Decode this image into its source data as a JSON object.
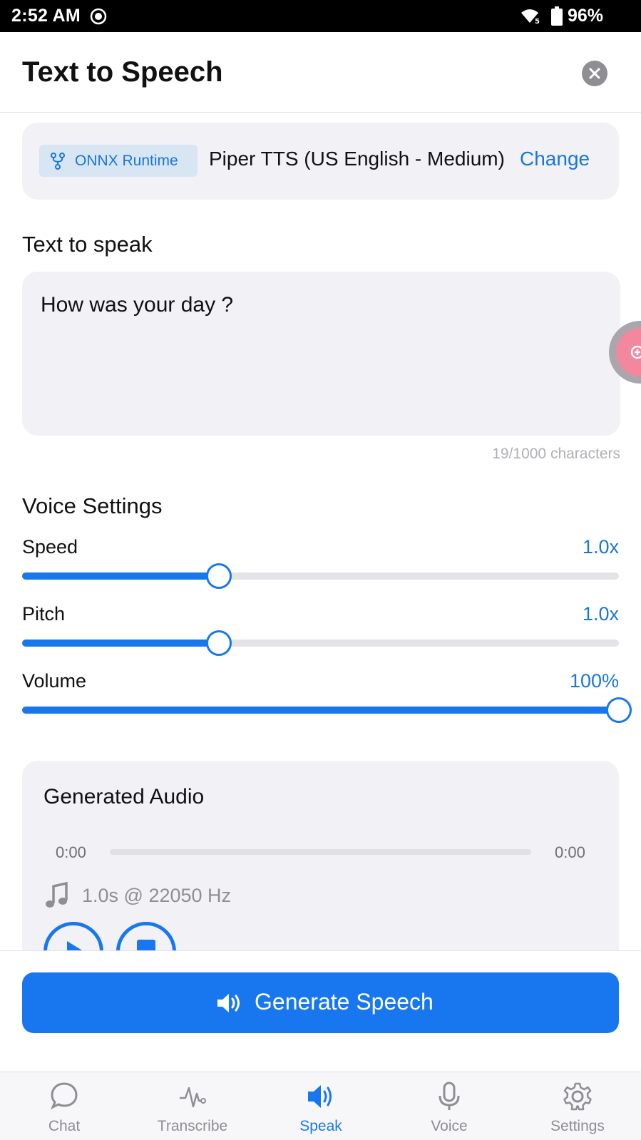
{
  "status_bar": {
    "time": "2:52 AM",
    "battery": "96%",
    "icons": [
      "recording-icon",
      "wifi-icon",
      "battery-icon"
    ]
  },
  "header": {
    "title": "Text to Speech",
    "close_icon": "close-icon"
  },
  "engine": {
    "badge_label": "ONNX Runtime",
    "badge_icon": "branch-icon",
    "model_name": "Piper TTS (US English - Medium)",
    "change_label": "Change"
  },
  "text_input": {
    "section_label": "Text to speak",
    "value": "How was your day ?",
    "char_count": "19/1000 characters"
  },
  "voice_settings": {
    "section_label": "Voice Settings",
    "speed": {
      "label": "Speed",
      "value_text": "1.0x",
      "fraction": 0.33
    },
    "pitch": {
      "label": "Pitch",
      "value_text": "1.0x",
      "fraction": 0.33
    },
    "volume": {
      "label": "Volume",
      "value_text": "100%",
      "fraction": 1.0
    }
  },
  "audio": {
    "title": "Generated Audio",
    "time_start": "0:00",
    "time_end": "0:00",
    "meta": "1.0s @ 22050 Hz",
    "meta_icon": "music-note-icon"
  },
  "actions": {
    "generate_label": "Generate Speech",
    "generate_icon": "speaker-icon"
  },
  "tabs": [
    {
      "label": "Chat",
      "icon": "chat-bubble-icon",
      "active": false
    },
    {
      "label": "Transcribe",
      "icon": "waveform-icon",
      "active": false
    },
    {
      "label": "Speak",
      "icon": "speaker-icon",
      "active": true
    },
    {
      "label": "Voice",
      "icon": "microphone-icon",
      "active": false
    },
    {
      "label": "Settings",
      "icon": "gear-icon",
      "active": false
    }
  ],
  "colors": {
    "accent": "#1877ee",
    "link": "#1877d8",
    "card_bg": "#f1f1f6",
    "muted": "#8e8e93"
  }
}
